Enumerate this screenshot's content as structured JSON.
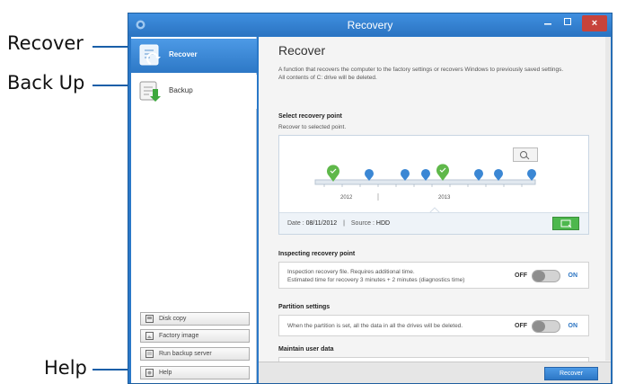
{
  "callouts": {
    "recover": "Recover",
    "backup": "Back Up",
    "help": "Help"
  },
  "window": {
    "title": "Recovery",
    "controls": {
      "close_glyph": "×"
    }
  },
  "sidebar": {
    "items": [
      {
        "label": "Recover",
        "icon": "recover-icon",
        "selected": true
      },
      {
        "label": "Backup",
        "icon": "backup-icon",
        "selected": false
      }
    ],
    "buttons": [
      {
        "label": "Disk copy",
        "icon": "disk-copy-icon"
      },
      {
        "label": "Factory image",
        "icon": "factory-image-icon"
      },
      {
        "label": "Run backup server",
        "icon": "backup-server-icon"
      },
      {
        "label": "Help",
        "icon": "help-icon"
      }
    ]
  },
  "main": {
    "title": "Recover",
    "description_line1": "A function that recovers the computer to the factory settings or recovers Windows to previously saved settings.",
    "description_line2": "All contents of C: drive will be deleted.",
    "recovery_point": {
      "heading": "Select recovery point",
      "subheading": "Recover to selected point.",
      "timeline_labels": [
        "2012",
        "2013"
      ],
      "date_label": "Date :",
      "date_value": "08/11/2012",
      "separator": "|",
      "source_label": "Source :",
      "source_value": "HDD"
    },
    "inspecting": {
      "heading": "Inspecting recovery point",
      "line1": "Inspection recovery file. Requires additional time.",
      "line2": "Estimated time for recovery 3 minutes + 2 minutes (diagnostics time)",
      "off": "OFF",
      "on": "ON",
      "state": "off"
    },
    "partition": {
      "heading": "Partition settings",
      "text": "When the partition is set, all the data in all the drives will be deleted.",
      "off": "OFF",
      "on": "ON",
      "state": "off"
    },
    "maintain": {
      "heading": "Maintain user data"
    },
    "recover_button": "Recover"
  },
  "colors": {
    "accent": "#2b74c2",
    "green": "#4db84d",
    "close": "#c7433b"
  }
}
